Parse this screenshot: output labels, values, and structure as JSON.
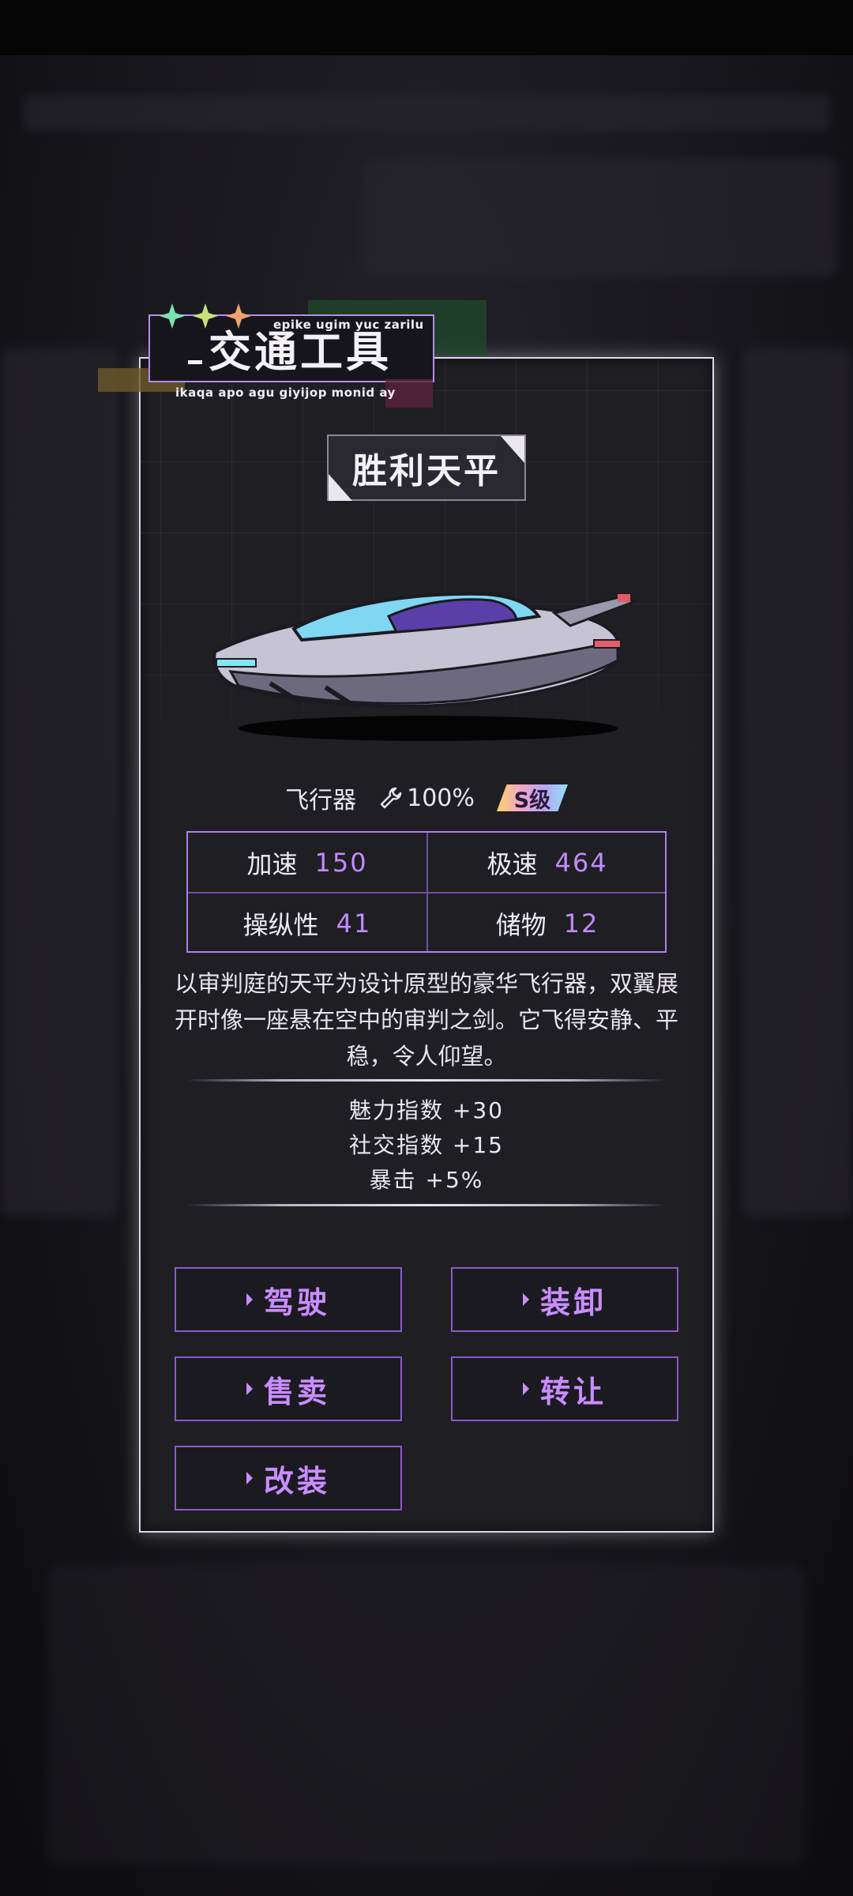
{
  "category": {
    "title": "交通工具",
    "sub_top": "epike ugim yuc zarilu",
    "sub_bottom": "ikaqa apo agu giyijop monid ay"
  },
  "vehicle": {
    "name": "胜利天平",
    "type": "飞行器",
    "durability": "100%",
    "grade": "S级"
  },
  "stats": [
    {
      "label": "加速",
      "value": "150"
    },
    {
      "label": "极速",
      "value": "464"
    },
    {
      "label": "操纵性",
      "value": "41"
    },
    {
      "label": "储物",
      "value": "12"
    }
  ],
  "description": "以审判庭的天平为设计原型的豪华飞行器，双翼展开时像一座悬在空中的审判之剑。它飞得安静、平稳，令人仰望。",
  "bonuses": [
    "魅力指数 +30",
    "社交指数 +15",
    "暴击 +5%"
  ],
  "buttons": {
    "drive": "驾驶",
    "equip": "装卸",
    "sell": "售卖",
    "transfer": "转让",
    "modify": "改装"
  },
  "colors": {
    "accent": "#c88dff",
    "panel_border": "#ddd6ee",
    "stat_border": "#b07ef0"
  }
}
